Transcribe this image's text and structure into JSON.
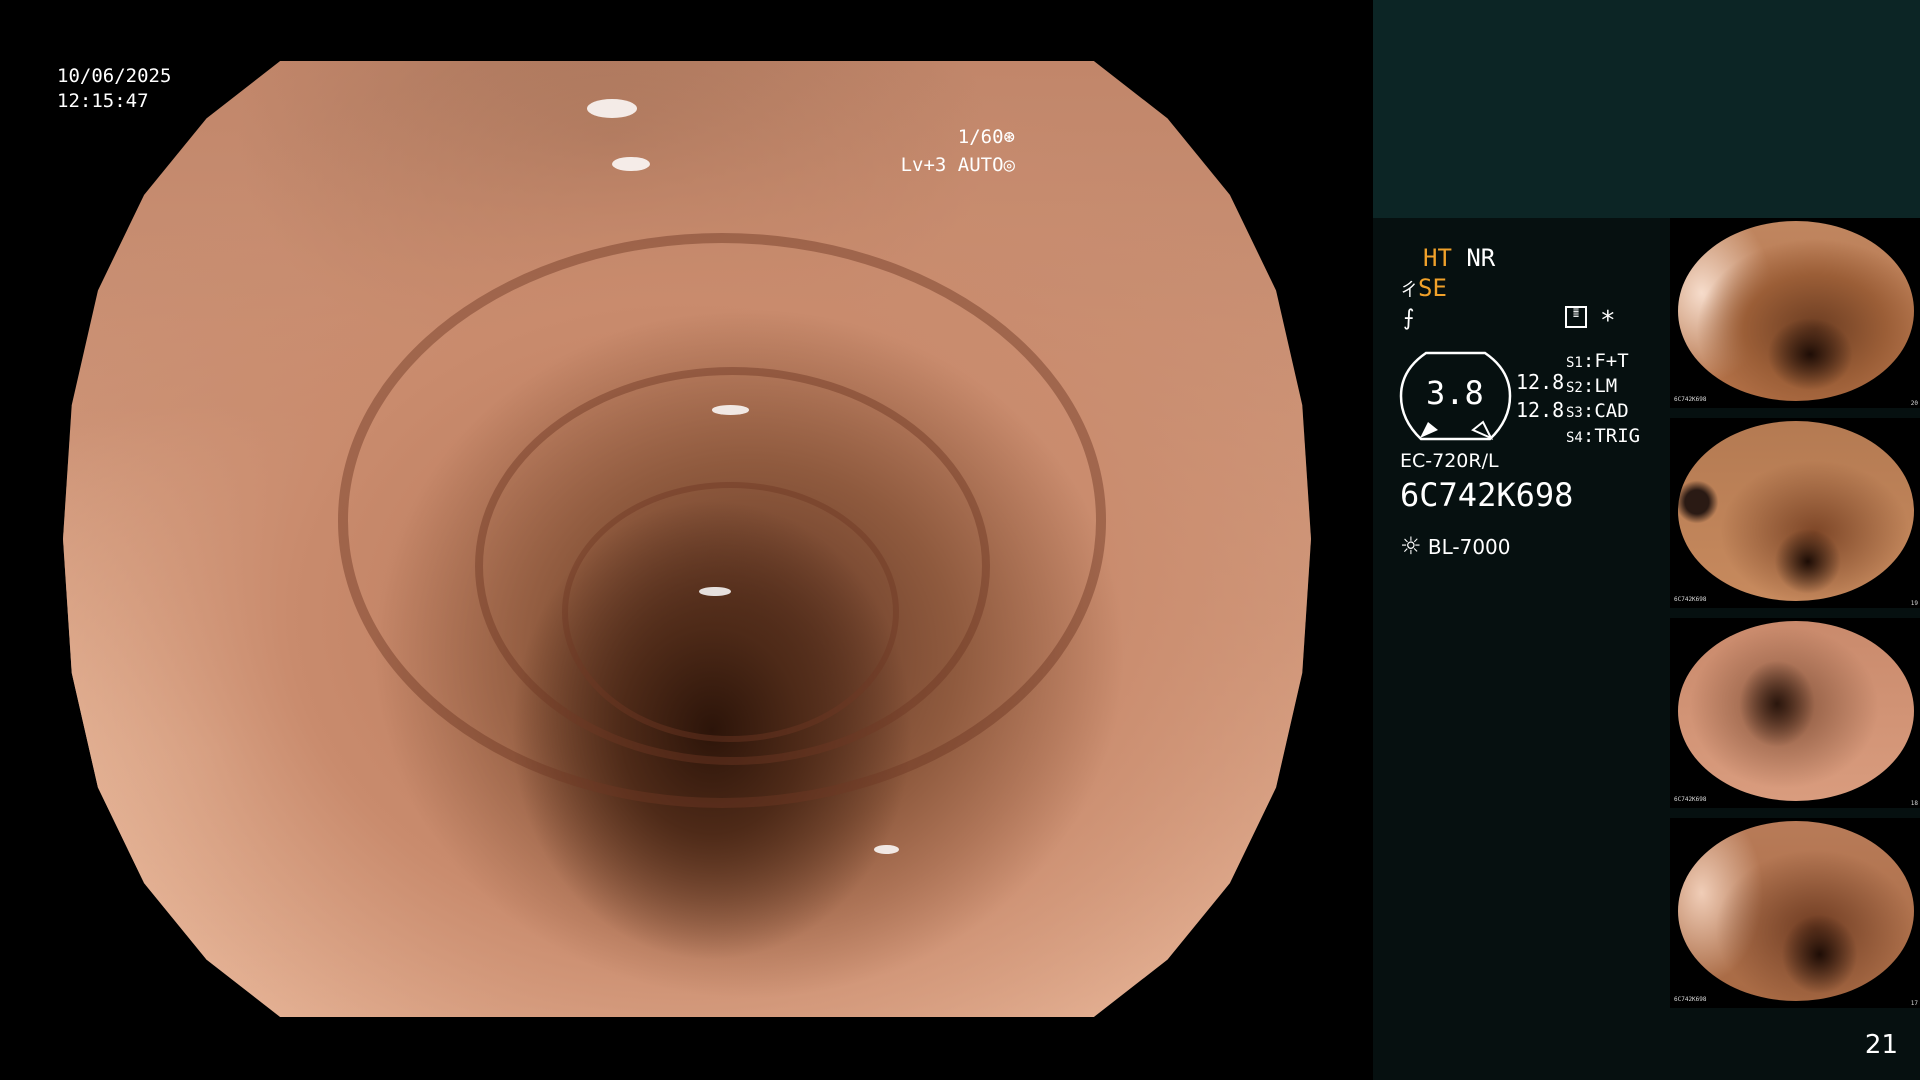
{
  "main": {
    "date": "10/06/2025",
    "time": "12:15:47",
    "shutter": "1/60",
    "shutter_icon": "aperture-icon",
    "level": "Lv+3 AUTO",
    "auto_icon": "iris-icon"
  },
  "panel": {
    "ht": "HT",
    "nr": "NR",
    "se": "SE",
    "se_icon": "structure-enhance-icon",
    "filter_icon": "f-symbol-icon",
    "menu_icon": "settings-list-icon",
    "star": "*",
    "gauge_value": "3.8",
    "values": [
      "12.8",
      "12.8"
    ],
    "switches": [
      {
        "key": "S1",
        "value": "F+T"
      },
      {
        "key": "S2",
        "value": "LM"
      },
      {
        "key": "S3",
        "value": "CAD"
      },
      {
        "key": "S4",
        "value": "TRIG"
      }
    ],
    "scope_model": "EC-720R/L",
    "serial": "6C742K698",
    "light_icon": "light-source-icon",
    "light_source": "BL-7000"
  },
  "thumbnails": [
    {
      "index": "20",
      "serial": "6C742K698"
    },
    {
      "index": "19",
      "serial": "6C742K698"
    },
    {
      "index": "18",
      "serial": "6C742K698"
    },
    {
      "index": "17",
      "serial": "6C742K698"
    }
  ],
  "page_number": "21"
}
